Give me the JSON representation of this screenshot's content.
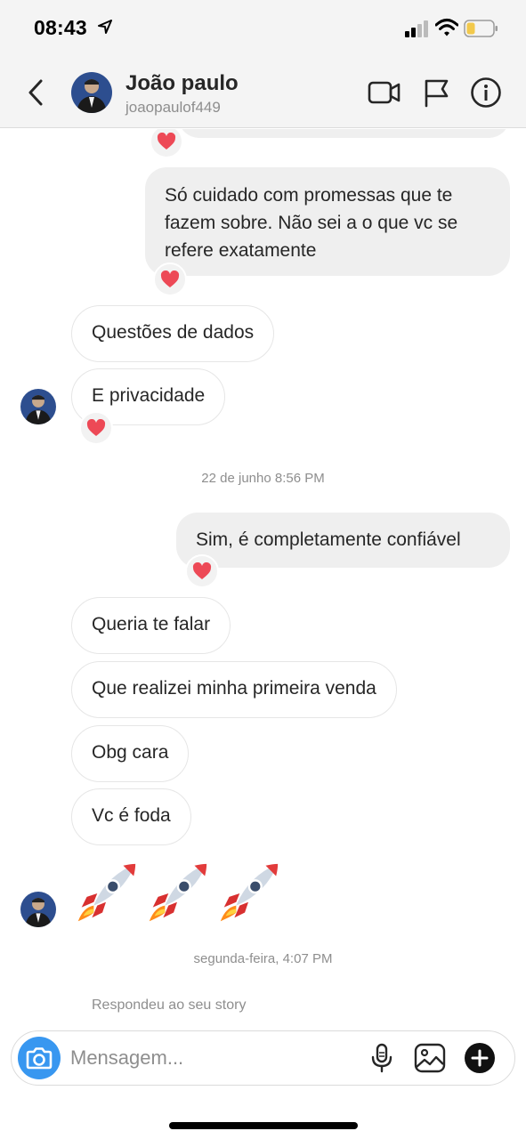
{
  "status_bar": {
    "time": "08:43"
  },
  "header": {
    "name": "João paulo",
    "username": "joaopaulof449"
  },
  "messages": {
    "out_1": "Só cuidado com promessas que te fazem sobre. Não sei a o que vc se refere exatamente",
    "in_1": "Questões de dados",
    "in_2": "E privacidade",
    "timestamp_1": "22 de junho 8:56 PM",
    "out_2": "Sim, é completamente confiável",
    "in_3": "Queria te falar",
    "in_4": "Que realizei minha primeira venda",
    "in_5": "Obg cara",
    "in_6": "Vc é foda",
    "timestamp_2": "segunda-feira, 4:07 PM",
    "story_note": "Respondeu ao seu story"
  },
  "composer": {
    "placeholder": "Mensagem..."
  },
  "icons": [
    "back-icon",
    "video-call-icon",
    "flag-icon",
    "info-icon",
    "heart-icon",
    "rocket-emoji",
    "camera-icon",
    "microphone-icon",
    "gallery-icon",
    "plus-icon"
  ],
  "colors": {
    "heart": "#ed4956",
    "camera": "#3897f0",
    "bubble_out": "#efefef"
  }
}
